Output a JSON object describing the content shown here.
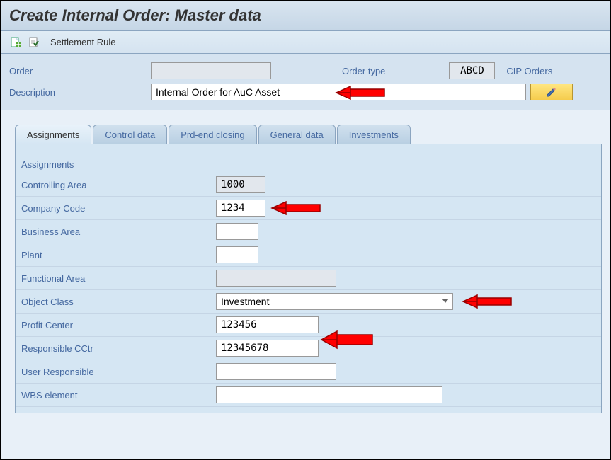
{
  "title": "Create Internal Order: Master data",
  "toolbar": {
    "settlement_label": "Settlement Rule"
  },
  "header": {
    "order_label": "Order",
    "order_value": "",
    "order_type_label": "Order type",
    "order_type_value": "ABCD",
    "cip_label": "CIP Orders",
    "desc_label": "Description",
    "desc_value": "Internal Order for AuC Asset"
  },
  "tabs": [
    {
      "label": "Assignments",
      "active": true
    },
    {
      "label": "Control data",
      "active": false
    },
    {
      "label": "Prd-end closing",
      "active": false
    },
    {
      "label": "General data",
      "active": false
    },
    {
      "label": "Investments",
      "active": false
    }
  ],
  "assignments": {
    "group_label": "Assignments",
    "rows": [
      {
        "label": "Controlling Area",
        "value": "1000",
        "readonly": true,
        "class": "w-small"
      },
      {
        "label": "Company Code",
        "value": "1234",
        "readonly": false,
        "class": "w-small"
      },
      {
        "label": "Business Area",
        "value": "",
        "readonly": false,
        "class": "w-med"
      },
      {
        "label": "Plant",
        "value": "",
        "readonly": false,
        "class": "w-med"
      },
      {
        "label": "Functional Area",
        "value": "",
        "readonly": true,
        "class": "w-xlong"
      },
      {
        "label": "Object Class",
        "value": "Investment",
        "type": "dropdown"
      },
      {
        "label": "Profit Center",
        "value": "123456",
        "readonly": false,
        "class": "w-long"
      },
      {
        "label": "Responsible CCtr",
        "value": "12345678",
        "readonly": false,
        "class": "w-long"
      },
      {
        "label": "User Responsible",
        "value": "",
        "readonly": false,
        "class": "w-xlong"
      },
      {
        "label": "WBS element",
        "value": "",
        "readonly": false,
        "class": "w-xxlong"
      }
    ]
  }
}
